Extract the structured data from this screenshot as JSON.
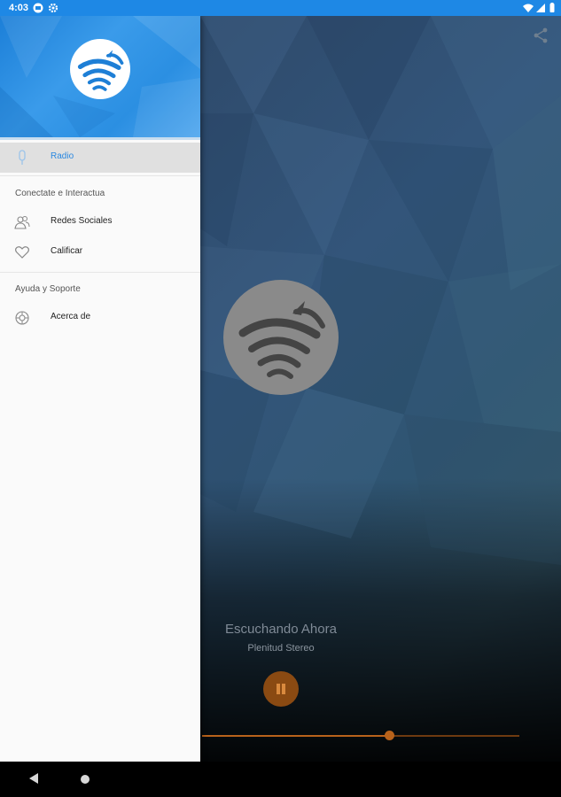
{
  "status_bar": {
    "time": "4:03",
    "left_icons": [
      "mail-icon",
      "gear-icon"
    ],
    "right_icons": [
      "wifi-icon",
      "signal-icon",
      "battery-icon"
    ],
    "color": "#1e88e5"
  },
  "drawer": {
    "header_logo": "radio-station-logo",
    "items": [
      {
        "label": "Radio",
        "icon": "microphone-icon",
        "active": true
      }
    ],
    "sections": [
      {
        "title": "Conectate e Interactua",
        "items": [
          {
            "label": "Redes Sociales",
            "icon": "people-icon"
          },
          {
            "label": "Calificar",
            "icon": "heart-icon"
          }
        ]
      },
      {
        "title": "Ayuda y Soporte",
        "items": [
          {
            "label": "Acerca de",
            "icon": "settings-icon"
          }
        ]
      }
    ],
    "accent": "#2a88e0"
  },
  "player": {
    "now_playing_label": "Escuchando Ahora",
    "station_name": "Plenitud Stereo",
    "state": "playing",
    "progress": 0.59,
    "accent": "#b8621b",
    "share_icon": "share-icon"
  },
  "nav_bar": {
    "icons": [
      "back-icon",
      "home-icon"
    ]
  }
}
